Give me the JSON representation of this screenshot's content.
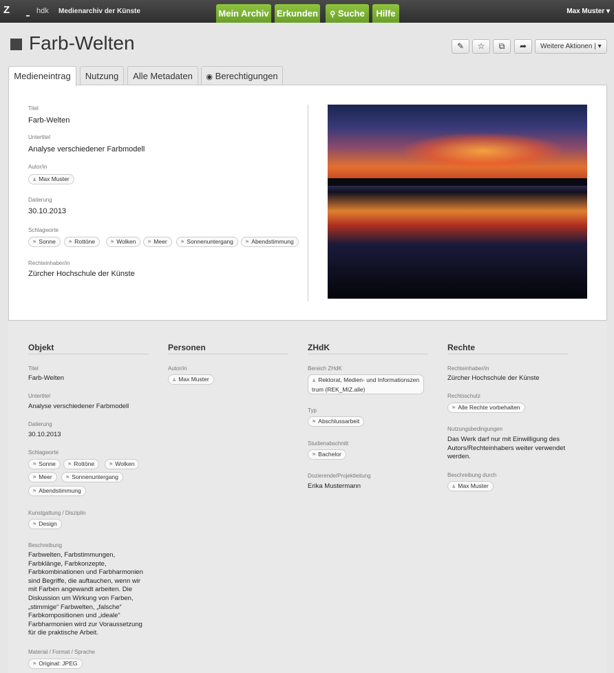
{
  "topbar": {
    "logo": "Z",
    "logo_text": "hdk",
    "app_name": "Medienarchiv der Künste",
    "nav": [
      "Mein Archiv",
      "Erkunden",
      "Suche",
      "Hilfe"
    ],
    "user": "Max Muster ▾"
  },
  "header": {
    "title": "Farb-Welten",
    "more_actions": "Weitere Aktionen | ▾"
  },
  "tabs": [
    "Medieneintrag",
    "Nutzung",
    "Alle Metadaten",
    "Berechtigungen"
  ],
  "entry": {
    "title_label": "Titel",
    "title": "Farb-Welten",
    "subtitle_label": "Untertitel",
    "subtitle": "Analyse verschiedener Farbmodell",
    "author_label": "Autor/in",
    "author": "Max Muster",
    "date_label": "Datierung",
    "date": "30.10.2013",
    "keywords_label": "Schlagworte",
    "keywords": [
      "Sonne",
      "Rottöne",
      "Wolken",
      "Meer",
      "Sonnenuntergang",
      "Abendstimmung"
    ],
    "rights_holder_label": "Rechteinhaber/in",
    "rights_holder": "Zürcher Hochschule der Künste"
  },
  "objekt": {
    "heading": "Objekt",
    "title_label": "Titel",
    "title": "Farb-Welten",
    "subtitle_label": "Untertitel",
    "subtitle": "Analyse verschiedener Farbmodell",
    "date_label": "Datierung",
    "date": "30.10.2013",
    "keywords_label": "Schlagworte",
    "keywords": [
      "Sonne",
      "Rottöne",
      "Wolken",
      "Meer",
      "Sonnenuntergang",
      "Abendstimmung"
    ],
    "genre_label": "Kunstgattung / Disziplin",
    "genre": "Design",
    "description_label": "Beschreibung",
    "description": "Farbwelten, Farbstimmungen, Farbklänge, Farbkonzepte, Farbkombinationen und Farbharmonien sind Begriffe, die auftauchen, wenn wir mit Farben angewandt arbeiten. Die Diskussion um Wirkung von Farben, „stimmige“ Farbwelten, „falsche“ Farbkompositionen und „ideale“ Farbharmonien wird zur Voraussetzung für die praktische Arbeit.",
    "format_label": "Material / Format / Sprache",
    "format": "Original: JPEG"
  },
  "personen": {
    "heading": "Personen",
    "author_label": "Autor/in",
    "author": "Max Muster"
  },
  "zhdk": {
    "heading": "ZHdK",
    "area_label": "Bereich ZHdK",
    "area_line1": "Rektorat, Medien- und Informationszen",
    "area_line2": "trum (REK_MIZ.alle)",
    "type_label": "Typ",
    "type": "Abschlussarbeit",
    "stage_label": "Studienabschnitt",
    "stage": "Bachelor",
    "lecturer_label": "Dozierende/Projektleitung",
    "lecturer": "Erika Mustermann"
  },
  "rechte": {
    "heading": "Rechte",
    "holder_label": "Rechteinhaber/in",
    "holder": "Zürcher Hochschule der Künste",
    "protection_label": "Rechtsschutz",
    "protection": "Alle Rechte vorbehalten",
    "terms_label": "Nutzungsbedingungen",
    "terms": "Das Werk darf nur mit Einwilligung des Autors/Rechteinhabers weiter verwendet werden.",
    "described_by_label": "Beschreibung durch",
    "described_by": "Max Muster"
  },
  "colors": {
    "nav_green": "#7bb236",
    "topbar": "#3a3a3a"
  }
}
